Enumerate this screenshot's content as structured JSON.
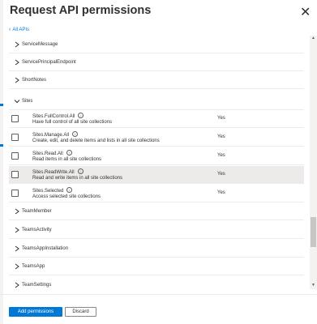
{
  "header": {
    "title": "Request API permissions",
    "close_label": "✕"
  },
  "nav": {
    "back_label": "All APIs"
  },
  "groups_before": [
    {
      "label": "ServiceMessage"
    },
    {
      "label": "ServicePrincipalEndpoint"
    },
    {
      "label": "ShortNotes"
    }
  ],
  "expanded_group": {
    "label": "Sites"
  },
  "permissions": [
    {
      "name": "Sites.FullControl.All",
      "description": "Have full control of all site collections",
      "admin_consent": "Yes"
    },
    {
      "name": "Sites.Manage.All",
      "description": "Create, edit, and delete items and lists in all site collections",
      "admin_consent": "Yes"
    },
    {
      "name": "Sites.Read.All",
      "description": "Read items in all site collections",
      "admin_consent": "Yes"
    },
    {
      "name": "Sites.ReadWrite.All",
      "description": "Read and write items in all site collections",
      "admin_consent": "Yes"
    },
    {
      "name": "Sites.Selected",
      "description": "Access selected site collections",
      "admin_consent": "Yes"
    }
  ],
  "groups_after": [
    {
      "label": "TeamMember"
    },
    {
      "label": "TeamsActivity"
    },
    {
      "label": "TeamsAppInstallation"
    },
    {
      "label": "TeamsApp"
    },
    {
      "label": "TeamSettings"
    }
  ],
  "footer": {
    "primary_label": "Add permissions",
    "secondary_label": "Discard"
  },
  "colors": {
    "accent": "#0078d4",
    "text": "#323130",
    "highlight_row": "#edebe9"
  }
}
